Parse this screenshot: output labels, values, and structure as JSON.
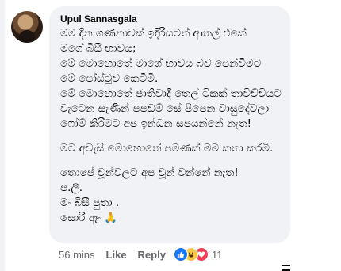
{
  "comment": {
    "author": "Upul Sannasgala",
    "lines": [
      "මම දින ගණනාවක් ඉදිරියටත් ආතල් එකේ",
      "මගේ බිසී භාවය;",
      " මේ මොහොතේ මාගේ භාවය බව පෙන්වීමට",
      "මේ පෝස්ටුව කෙටීමි.",
      "මේ මොහොතේ ජාතිවාදී තෙල් ටිකක් තාවිච්චියට",
      "වැටෙන සැණින් පපඩම් සේ පිපෙන වාසුදේවලා",
      "ෆෝම් කිරීමට අප ඉන්ධන සපයන්නේ නැත!",
      "මට අවැසි මොහොතේ පමණක් මම කතා කරමි.",
      "තොපේ චූන්වලට අප චූන් වන්නේ නැත!",
      "ප.ලි.",
      "මං බිසී පුතා .",
      "සොරි ඈං 🙏"
    ]
  },
  "actions": {
    "time": "56 mins",
    "like_label": "Like",
    "reply_label": "Reply",
    "reaction_count": "11"
  },
  "reaction_icons": [
    "like-icon",
    "haha-icon",
    "love-icon"
  ]
}
